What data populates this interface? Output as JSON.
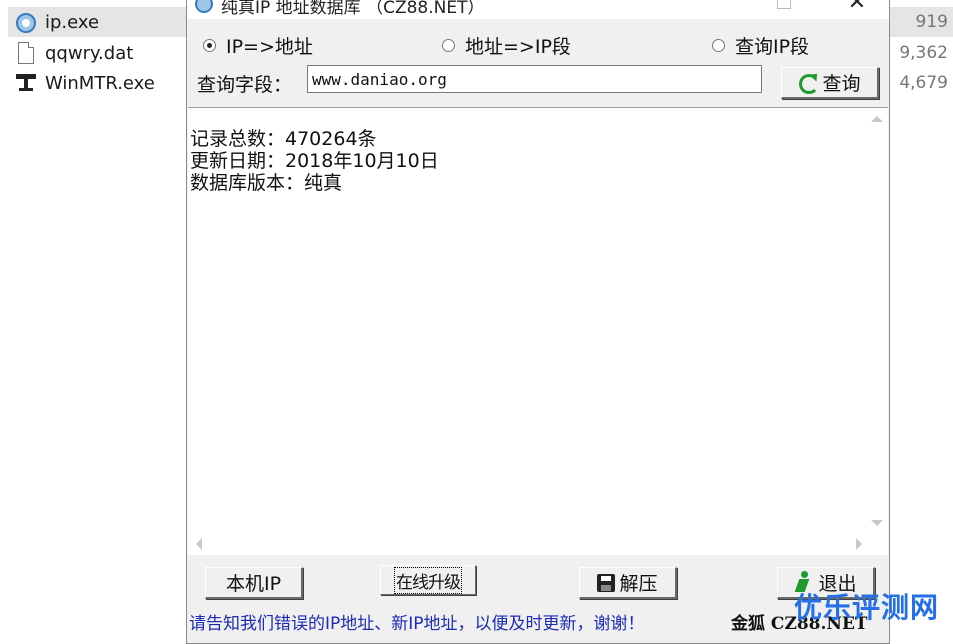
{
  "explorer": {
    "files": [
      {
        "name": "ip.exe",
        "size": "919",
        "icon": "ip-app-icon"
      },
      {
        "name": "qqwry.dat",
        "size": "9,362",
        "icon": "file-icon"
      },
      {
        "name": "WinMTR.exe",
        "size": "4,679",
        "icon": "winmtr-icon"
      }
    ]
  },
  "window": {
    "title": "纯真IP 地址数据库 （CZ88.NET）",
    "close_glyph": "✕",
    "radio": {
      "ip_to_addr": "IP=>地址",
      "addr_to_ip": "地址=>IP段",
      "query_ip_range": "查询IP段"
    },
    "query_label": "查询字段：",
    "query_value": "www.daniao.org",
    "query_button": "查询",
    "result_lines": [
      "记录总数：470264条",
      "更新日期：2018年10月10日",
      "数据库版本：纯真"
    ],
    "buttons": {
      "local_ip": "本机IP",
      "online_update": "在线升级",
      "unzip": "解压",
      "exit": "退出"
    },
    "status_text": "请告知我们错误的IP地址、新IP地址，以便及时更新，谢谢！",
    "status_brand": "金狐 CZ88.NET"
  },
  "watermark": "优乐评测网"
}
